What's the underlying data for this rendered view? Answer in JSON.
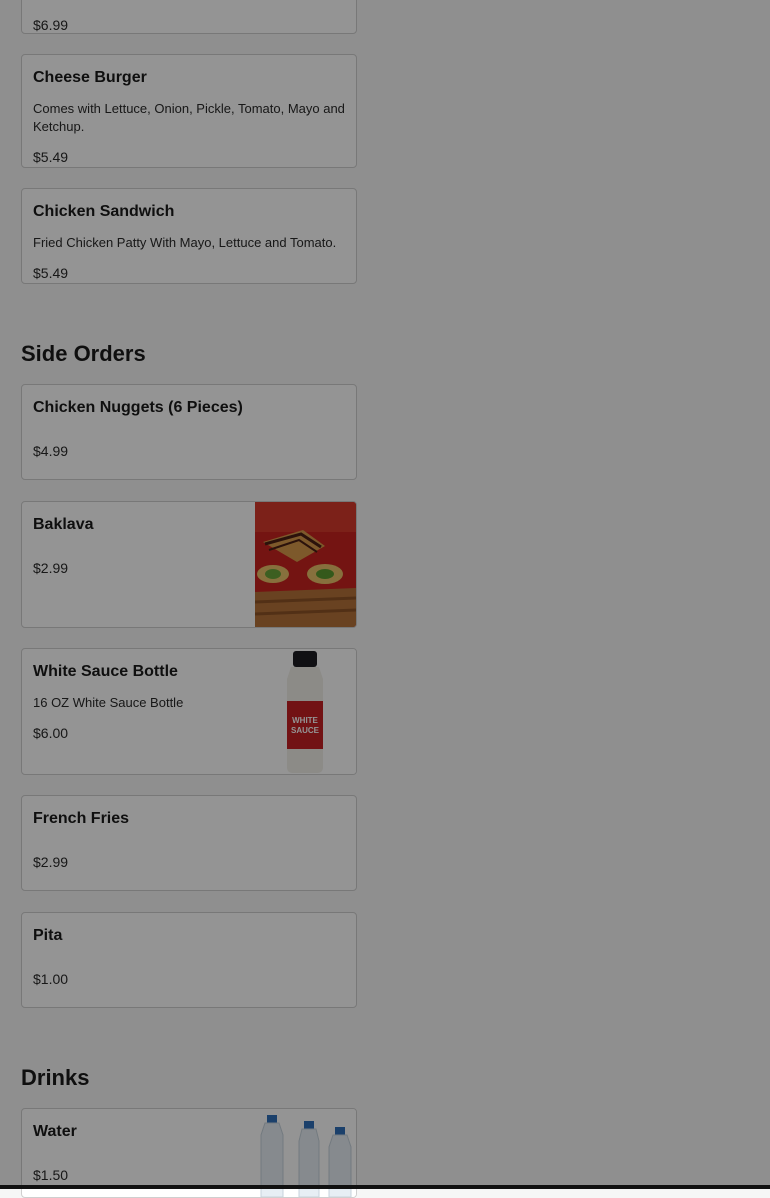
{
  "items_top": {
    "partial_price": "$6.99",
    "cheese_burger": {
      "name": "Cheese Burger",
      "desc": "Comes with Lettuce, Onion, Pickle, Tomato, Mayo and Ketchup.",
      "price": "$5.49"
    },
    "chicken_sandwich": {
      "name": "Chicken Sandwich",
      "desc": "Fried Chicken Patty With Mayo, Lettuce and Tomato.",
      "price": "$5.49"
    }
  },
  "side_orders": {
    "title": "Side Orders",
    "items": [
      {
        "name": "Chicken Nuggets (6 Pieces)",
        "desc": "",
        "price": "$4.99"
      },
      {
        "name": "Baklava",
        "desc": "",
        "price": "$2.99",
        "image": "baklava-photo"
      },
      {
        "name": "White Sauce Bottle",
        "desc": "16 OZ White Sauce Bottle",
        "price": "$6.00",
        "image": "white-sauce-bottle-photo",
        "bottle_label": "WHITE SAUCE"
      },
      {
        "name": "French Fries",
        "desc": "",
        "price": "$2.99"
      },
      {
        "name": "Pita",
        "desc": "",
        "price": "$1.00"
      }
    ]
  },
  "drinks": {
    "title": "Drinks",
    "items": [
      {
        "name": "Water",
        "desc": "",
        "price": "$1.50",
        "image": "water-bottles-photo"
      }
    ]
  },
  "colors": {
    "background": "#f6f6f6",
    "card": "#ffffff",
    "overlay": "rgba(0,0,0,0.42)"
  }
}
